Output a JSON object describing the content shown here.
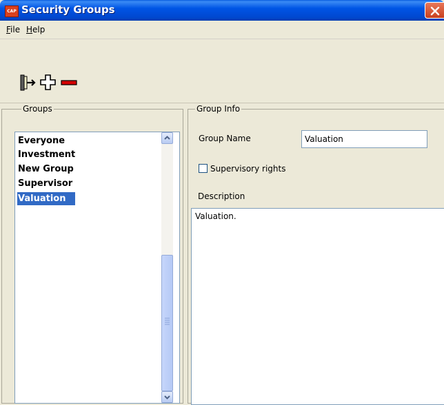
{
  "window": {
    "icon_text": "CAP",
    "title": "Security Groups"
  },
  "menu": {
    "items": [
      {
        "key": "F",
        "rest": "ile"
      },
      {
        "key": "H",
        "rest": "elp"
      }
    ]
  },
  "toolbar": {
    "buttons": [
      "exit-icon",
      "add-icon",
      "remove-icon"
    ]
  },
  "groups_panel": {
    "title": "Groups",
    "items": [
      {
        "label": "Everyone",
        "selected": false
      },
      {
        "label": "Investment",
        "selected": false
      },
      {
        "label": "New Group",
        "selected": false
      },
      {
        "label": "Supervisor",
        "selected": false
      },
      {
        "label": "Valuation",
        "selected": true
      }
    ]
  },
  "info_panel": {
    "title": "Group Info",
    "group_name_label": "Group Name",
    "group_name_value": "Valuation",
    "supervisory_label": "Supervisory rights",
    "supervisory_checked": false,
    "description_label": "Description",
    "description_value": "Valuation."
  },
  "colors": {
    "title_bar": "#0055e5",
    "selection": "#316ac5",
    "close_button": "#d9401e",
    "remove_icon": "#d40000"
  }
}
